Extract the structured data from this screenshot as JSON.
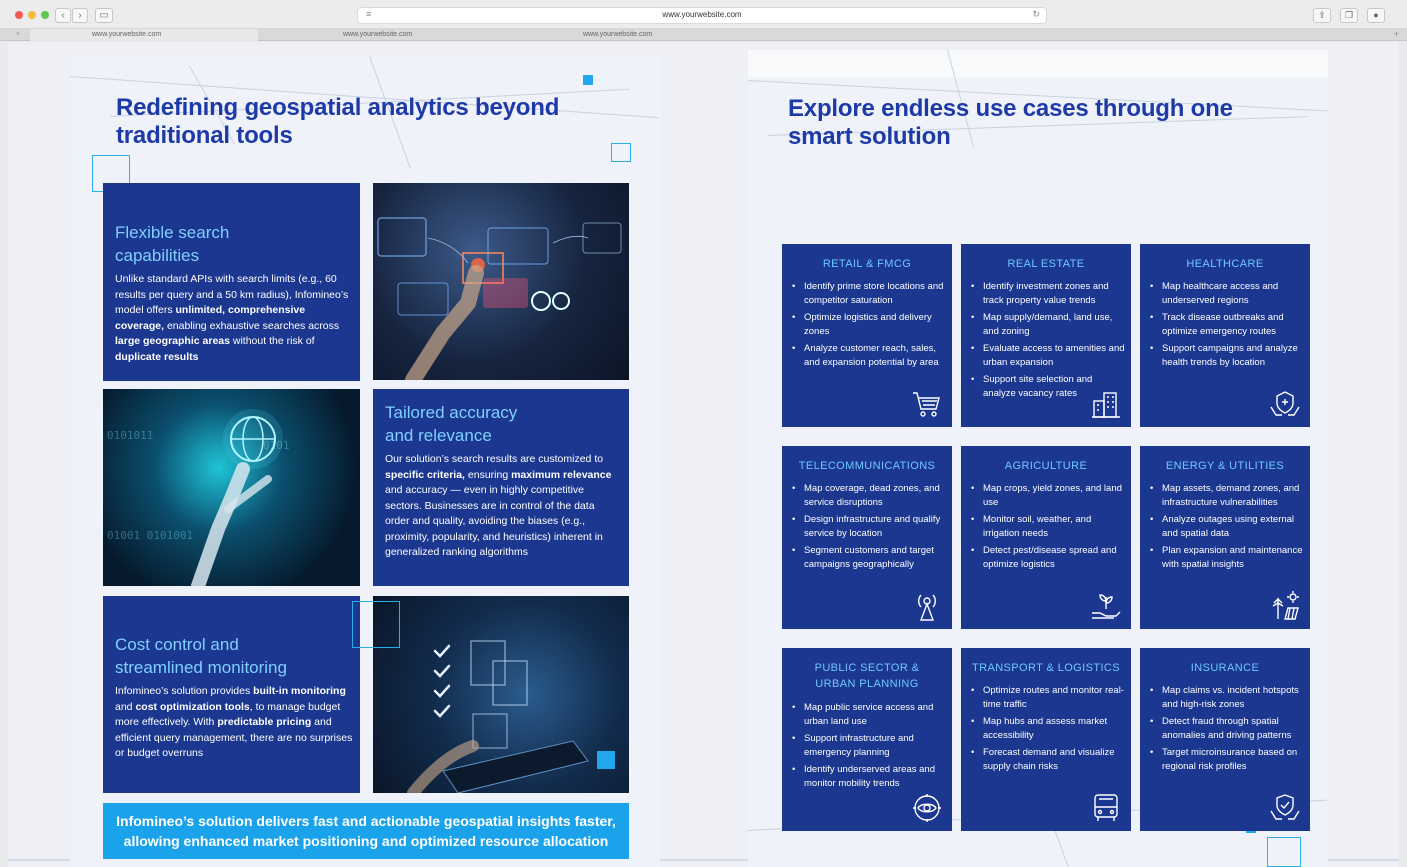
{
  "browser": {
    "url": "www.yourwebsite.com",
    "tabs": [
      "www.yourwebsite.com",
      "www.yourwebsite.com",
      "www.yourwebsite.com"
    ]
  },
  "left": {
    "title_line1": "Redefining geospatial analytics beyond",
    "title_line2": "traditional tools",
    "card1": {
      "title_line1": "Flexible search",
      "title_line2": "capabilities",
      "body": [
        {
          "t": "Unlike standard APIs with search limits (e.g., 60 results per query and a 50 km radius), Infomineo’s model offers ",
          "b": false
        },
        {
          "t": "unlimited, comprehensive coverage,",
          "b": true
        },
        {
          "t": " enabling exhaustive searches across ",
          "b": false
        },
        {
          "t": "large geographic areas",
          "b": true
        },
        {
          "t": " without the risk of ",
          "b": false
        },
        {
          "t": "duplicate results",
          "b": true
        }
      ]
    },
    "card2": {
      "title_line1": "Tailored accuracy",
      "title_line2": "and relevance",
      "body": [
        {
          "t": "Our solution’s search results are customized to ",
          "b": false
        },
        {
          "t": "specific criteria,",
          "b": true
        },
        {
          "t": " ensuring ",
          "b": false
        },
        {
          "t": "maximum relevance",
          "b": true
        },
        {
          "t": " and accuracy — even in highly competitive sectors. Businesses are in control of the data order and quality, avoiding the biases (e.g., proximity, popularity, and heuristics) inherent in generalized ranking algorithms",
          "b": false
        }
      ]
    },
    "card3": {
      "title_line1": "Cost control and",
      "title_line2": "streamlined monitoring",
      "body": [
        {
          "t": "Infomineo’s solution provides ",
          "b": false
        },
        {
          "t": "built-in monitoring",
          "b": true
        },
        {
          "t": " and ",
          "b": false
        },
        {
          "t": "cost optimization tools",
          "b": true
        },
        {
          "t": ", to manage budget more effectively. With ",
          "b": false
        },
        {
          "t": "predictable pricing",
          "b": true
        },
        {
          "t": " and efficient query management, there are no surprises or budget overruns",
          "b": false
        }
      ]
    },
    "banner_line1": "Infomineo’s solution delivers fast and actionable geospatial insights faster,",
    "banner_line2": "allowing enhanced market positioning and optimized resource allocation"
  },
  "right": {
    "title_line1": "Explore endless use cases through one",
    "title_line2": "smart solution",
    "cards": [
      {
        "title": "RETAIL & FMCG",
        "icon": "cart-icon",
        "items": [
          "Identify prime store locations and competitor saturation",
          "Optimize logistics and delivery zones",
          "Analyze customer reach, sales, and expansion potential by area"
        ]
      },
      {
        "title": "REAL ESTATE",
        "icon": "buildings-icon",
        "items": [
          "Identify investment zones and track property value trends",
          "Map supply/demand, land use, and zoning",
          "Evaluate access to amenities and urban expansion",
          "Support site selection and analyze vacancy rates"
        ]
      },
      {
        "title": "HEALTHCARE",
        "icon": "health-hands-icon",
        "items": [
          "Map healthcare access and underserved regions",
          "Track disease outbreaks and optimize emergency routes",
          "Support campaigns and analyze health trends by location"
        ]
      },
      {
        "title": "TELECOMMUNICATIONS",
        "icon": "antenna-icon",
        "items": [
          "Map coverage, dead zones, and service disruptions",
          "Design infrastructure and qualify service by location",
          "Segment customers and target campaigns geographically"
        ]
      },
      {
        "title": "AGRICULTURE",
        "icon": "plant-hand-icon",
        "items": [
          "Map crops, yield zones, and land use",
          "Monitor soil, weather, and irrigation needs",
          "Detect pest/disease spread and optimize logistics"
        ]
      },
      {
        "title": "ENERGY & UTILITIES",
        "icon": "energy-icon",
        "items": [
          "Map assets, demand zones, and infrastructure vulnerabilities",
          "Analyze outages using external and spatial data",
          "Plan expansion and maintenance with spatial insights"
        ]
      },
      {
        "title_line1": "PUBLIC SECTOR &",
        "title_line2": "URBAN PLANNING",
        "title": "PUBLIC SECTOR & URBAN PLANNING",
        "icon": "eye-gear-icon",
        "items": [
          "Map public service access and urban land use",
          "Support infrastructure and emergency planning",
          "Identify underserved areas and monitor mobility trends"
        ]
      },
      {
        "title": "TRANSPORT & LOGISTICS",
        "icon": "bus-icon",
        "items": [
          "Optimize routes and monitor real-time traffic",
          "Map hubs and assess market accessibility",
          "Forecast demand and visualize supply chain risks"
        ]
      },
      {
        "title": "INSURANCE",
        "icon": "shield-hands-icon",
        "items": [
          "Map claims vs. incident hotspots and high-risk zones",
          "Detect fraud through spatial anomalies and driving patterns",
          "Target microinsurance based on regional risk profiles"
        ]
      }
    ]
  }
}
